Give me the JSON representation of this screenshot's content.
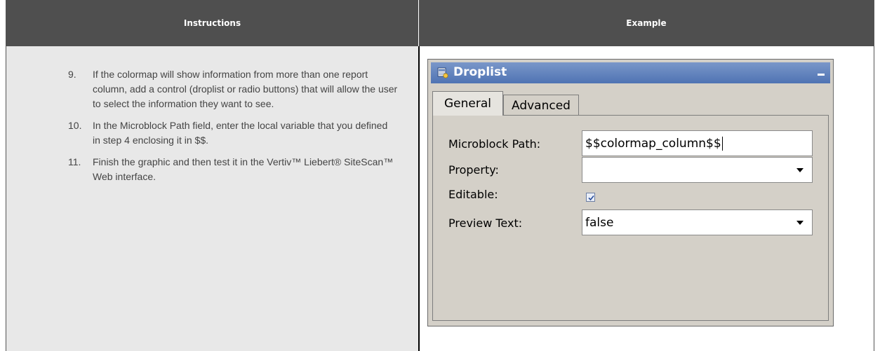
{
  "table": {
    "headers": [
      "Instructions",
      "Example"
    ]
  },
  "steps": [
    {
      "number": "9.",
      "text": "If the colormap will show information from more than one report column, add a control (droplist or radio buttons) that will allow the user to select the information they want to see."
    },
    {
      "number": "10.",
      "text": "In the Microblock Path field, enter the local variable that you defined in step  4 enclosing it in $$."
    },
    {
      "number": "11.",
      "text": "Finish the graphic and then test it in the Vertiv™ Liebert® SiteScan™ Web interface."
    }
  ],
  "panel": {
    "title": "Droplist",
    "icon": "droplist-icon",
    "tabs": [
      {
        "label": "General",
        "active": true
      },
      {
        "label": "Advanced",
        "active": false
      }
    ],
    "fields": {
      "microblock_path": {
        "label": "Microblock Path:",
        "value": "$$colormap_column$$"
      },
      "property": {
        "label": "Property:",
        "value": ""
      },
      "editable": {
        "label": "Editable:",
        "checked": true
      },
      "preview_text": {
        "label": "Preview Text:",
        "value": "false"
      }
    }
  },
  "colors": {
    "header_bg": "#4f4f4f",
    "instructions_bg": "#e8e8e8",
    "title_bar": "#5a7cb9",
    "panel_bg": "#d4d0c8"
  }
}
